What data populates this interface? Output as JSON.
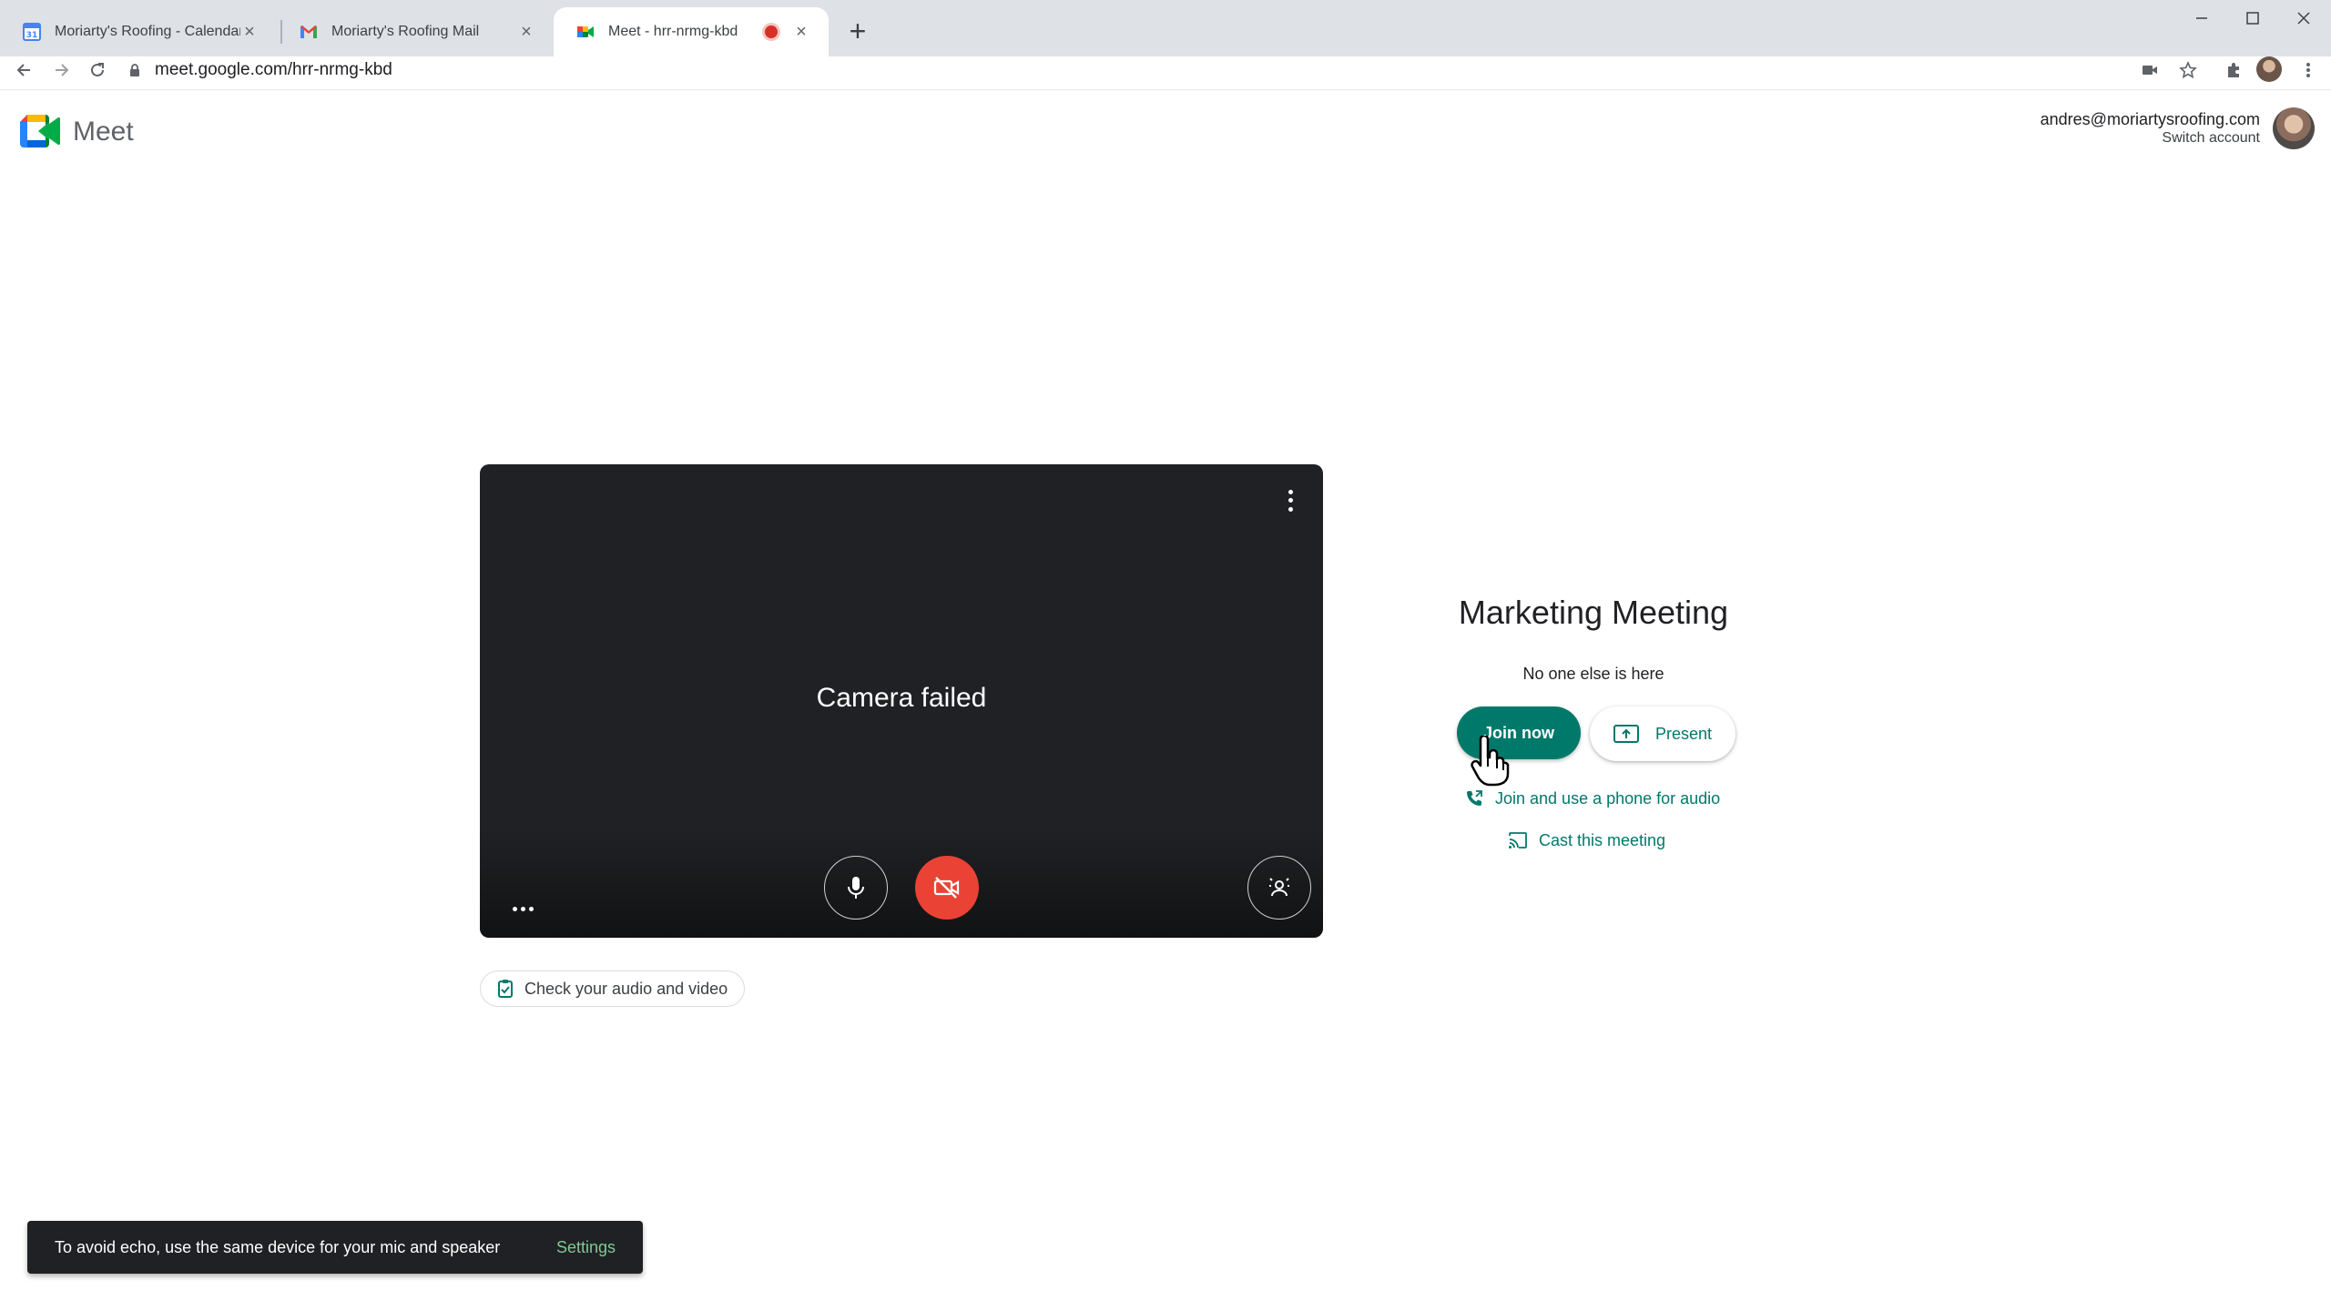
{
  "browser": {
    "tabs": [
      {
        "title": "Moriarty's Roofing - Calendar - W",
        "favicon": "calendar-icon"
      },
      {
        "title": "Moriarty's Roofing Mail",
        "favicon": "gmail-icon"
      },
      {
        "title": "Meet - hrr-nrmg-kbd",
        "favicon": "meet-icon",
        "recording": true
      }
    ],
    "url": "meet.google.com/hrr-nrmg-kbd"
  },
  "header": {
    "app_name": "Meet",
    "email": "andres@moriartysroofing.com",
    "switch_account": "Switch account"
  },
  "preview": {
    "status": "Camera failed",
    "check_audio_video": "Check your audio and video"
  },
  "join": {
    "meeting_title": "Marketing Meeting",
    "participants_status": "No one else is here",
    "join_now": "Join now",
    "present": "Present",
    "join_phone": "Join and use a phone for audio",
    "cast": "Cast this meeting"
  },
  "snackbar": {
    "message": "To avoid echo, use the same device for your mic and speaker",
    "action": "Settings"
  },
  "colors": {
    "accent": "#00796b",
    "mic_off_red": "#ea4335",
    "preview_bg": "#202124"
  }
}
